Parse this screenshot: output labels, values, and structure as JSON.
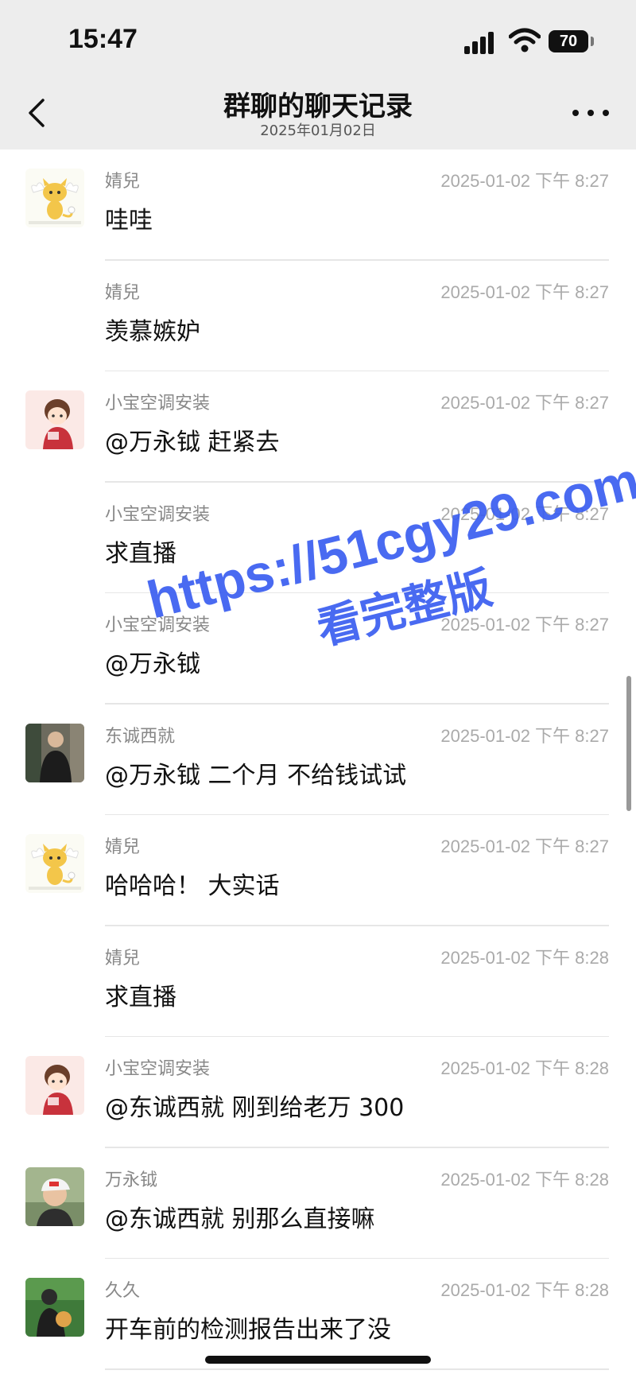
{
  "status_bar": {
    "time": "15:47",
    "battery": "70"
  },
  "header": {
    "title": "群聊的聊天记录",
    "subtitle": "2025年01月02日"
  },
  "messages": [
    {
      "sender": "婧兒",
      "time": "2025-01-02 下午 8:27",
      "text": "哇哇",
      "avatar": "angel-cat"
    },
    {
      "sender": "婧兒",
      "time": "2025-01-02 下午 8:27",
      "text": "羡慕嫉妒",
      "avatar": ""
    },
    {
      "sender": "小宝空调安装",
      "time": "2025-01-02 下午 8:27",
      "text": "@万永钺 赶紧去",
      "avatar": "cartoon-boy"
    },
    {
      "sender": "小宝空调安装",
      "time": "2025-01-02 下午 8:27",
      "text": "求直播",
      "avatar": ""
    },
    {
      "sender": "小宝空调安装",
      "time": "2025-01-02 下午 8:27",
      "text": "@万永钺",
      "avatar": ""
    },
    {
      "sender": "东诚西就",
      "time": "2025-01-02 下午 8:27",
      "text": "@万永钺 二个月 不给钱试试",
      "avatar": "man-photo"
    },
    {
      "sender": "婧兒",
      "time": "2025-01-02 下午 8:27",
      "text": "哈哈哈！ 大实话",
      "avatar": "angel-cat"
    },
    {
      "sender": "婧兒",
      "time": "2025-01-02 下午 8:28",
      "text": "求直播",
      "avatar": ""
    },
    {
      "sender": "小宝空调安装",
      "time": "2025-01-02 下午 8:28",
      "text": "@东诚西就 刚到给老万 300",
      "avatar": "cartoon-boy"
    },
    {
      "sender": "万永钺",
      "time": "2025-01-02 下午 8:28",
      "text": "@东诚西就 别那么直接嘛",
      "avatar": "cap-man-photo"
    },
    {
      "sender": "久久",
      "time": "2025-01-02 下午 8:28",
      "text": "开车前的检测报告出来了没",
      "avatar": "person-outdoor-photo"
    }
  ],
  "watermark": {
    "url": "https://51cgy29.com",
    "text": "看完整版"
  },
  "colors": {
    "background": "#ffffff",
    "header": "#ededed",
    "watermark": "#3a5ef0"
  }
}
